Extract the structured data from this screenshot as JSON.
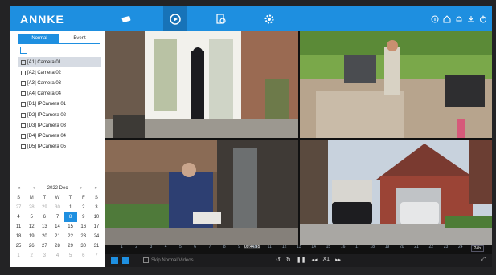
{
  "brand": {
    "logo": "ANNKE"
  },
  "topnav": [
    {
      "name": "camera",
      "active": false
    },
    {
      "name": "playback",
      "active": true
    },
    {
      "name": "search",
      "active": false
    },
    {
      "name": "settings",
      "active": false
    }
  ],
  "sidebar": {
    "tabs": [
      "Normal",
      "Event"
    ],
    "active_tab": "Normal",
    "cameras": [
      {
        "label": "[A1] Camera 01",
        "checked": true,
        "selected": true
      },
      {
        "label": "[A2] Camera 02",
        "checked": false
      },
      {
        "label": "[A3] Camera 03",
        "checked": false
      },
      {
        "label": "[A4] Camera 04",
        "checked": false
      },
      {
        "label": "[D1] IPCamera 01",
        "checked": false
      },
      {
        "label": "[D2] IPCamera 02",
        "checked": false
      },
      {
        "label": "[D3] IPCamera 03",
        "checked": false
      },
      {
        "label": "[D4] IPCamera 04",
        "checked": false
      },
      {
        "label": "[D5] IPCamera 05",
        "checked": false
      }
    ]
  },
  "calendar": {
    "prev_year": "«",
    "prev_month": "‹",
    "title": "2022 Dec",
    "next_month": "›",
    "next_year": "»",
    "weekdays": [
      "S",
      "M",
      "T",
      "W",
      "T",
      "F",
      "S"
    ],
    "days": [
      "27",
      "28",
      "29",
      "30",
      "1",
      "2",
      "3",
      "4",
      "5",
      "6",
      "7",
      "8",
      "9",
      "10",
      "11",
      "12",
      "13",
      "14",
      "15",
      "16",
      "17",
      "18",
      "19",
      "20",
      "21",
      "22",
      "23",
      "24",
      "25",
      "26",
      "27",
      "28",
      "29",
      "30",
      "31",
      "1",
      "2",
      "3",
      "4",
      "5",
      "6",
      "7"
    ],
    "muted_days_index": [
      0,
      1,
      2,
      3,
      35,
      36,
      37,
      38,
      39,
      40,
      41
    ],
    "today_index": 11
  },
  "timeline": {
    "ticks": [
      "1",
      "2",
      "3",
      "4",
      "5",
      "6",
      "7",
      "8",
      "9",
      "10",
      "11",
      "12",
      "13",
      "14",
      "15",
      "16",
      "17",
      "18",
      "19",
      "20",
      "21",
      "22",
      "23",
      "24"
    ],
    "current_time": "09:44:45",
    "range": "24h"
  },
  "controls": {
    "skip_label": "Skip Normal Videos",
    "speed": "X1"
  },
  "colors": {
    "accent": "#1e8fe0",
    "topbar": "#1e8fe0",
    "cursor": "#e0443a"
  }
}
